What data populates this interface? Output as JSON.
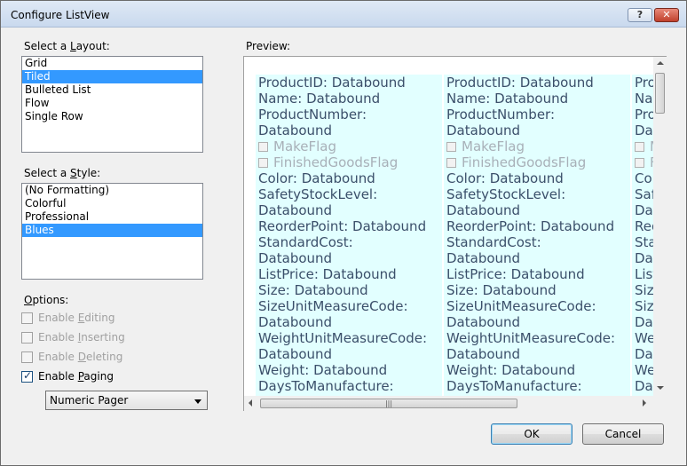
{
  "window": {
    "title": "Configure ListView",
    "help_glyph": "?",
    "close_glyph": "✕"
  },
  "layout": {
    "label_pre": "Select a ",
    "label_key": "L",
    "label_post": "ayout:",
    "items": [
      "Grid",
      "Tiled",
      "Bulleted List",
      "Flow",
      "Single Row"
    ],
    "selected": "Tiled"
  },
  "style": {
    "label_pre": "Select a ",
    "label_key": "S",
    "label_post": "tyle:",
    "items": [
      "(No Formatting)",
      "Colorful",
      "Professional",
      "Blues"
    ],
    "selected": "Blues"
  },
  "options": {
    "label_key": "O",
    "label_post": "ptions:",
    "enable_editing": {
      "pre": "Enable ",
      "key": "E",
      "post": "diting",
      "checked": false,
      "enabled": false
    },
    "enable_inserting": {
      "pre": "Enable ",
      "key": "I",
      "post": "nserting",
      "checked": false,
      "enabled": false
    },
    "enable_deleting": {
      "pre": "Enable ",
      "key": "D",
      "post": "eleting",
      "checked": false,
      "enabled": false
    },
    "enable_paging": {
      "pre": "Enable ",
      "key": "P",
      "post": "aging",
      "checked": true,
      "enabled": true
    },
    "pager_type": "Numeric Pager"
  },
  "preview": {
    "label": "Preview:",
    "tile_lines": [
      {
        "text": "ProductID: Databound"
      },
      {
        "text": "Name: Databound"
      },
      {
        "text": "ProductNumber:"
      },
      {
        "text": "Databound"
      },
      {
        "text": "MakeFlag",
        "checkbox": true
      },
      {
        "text": "FinishedGoodsFlag",
        "checkbox": true
      },
      {
        "text": "Color: Databound"
      },
      {
        "text": "SafetyStockLevel:"
      },
      {
        "text": "Databound"
      },
      {
        "text": "ReorderPoint: Databound"
      },
      {
        "text": "StandardCost:"
      },
      {
        "text": "Databound"
      },
      {
        "text": "ListPrice: Databound"
      },
      {
        "text": "Size: Databound"
      },
      {
        "text": "SizeUnitMeasureCode:"
      },
      {
        "text": "Databound"
      },
      {
        "text": "WeightUnitMeasureCode:"
      },
      {
        "text": "Databound"
      },
      {
        "text": "Weight: Databound"
      },
      {
        "text": "DaysToManufacture:"
      }
    ],
    "tile_count": 3,
    "hscroll_grip": "|||"
  },
  "buttons": {
    "ok": "OK",
    "cancel": "Cancel"
  },
  "colors": {
    "selection": "#3399ff",
    "tile_background": "#e2ffff",
    "tile_text": "#3b4f6a"
  }
}
